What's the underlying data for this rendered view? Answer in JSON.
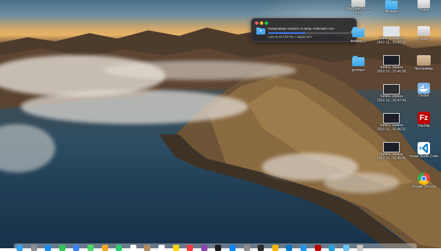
{
  "copy_dialog": {
    "title": "Копирование «Docker» в папку «Рабочий стол»",
    "status": "1,02 ГБ из 1,97 ГБ — около 10 с",
    "progress_fraction": 0.45,
    "cancel_glyph": "✕",
    "icon": "folder-icon"
  },
  "desktop_icons": [
    {
      "label": "MacBook Pro —",
      "label2": "Root",
      "icon": "drive-icon"
    },
    {
      "label": "Фильмы",
      "label2": "",
      "icon": "movies-folder-icon"
    },
    {
      "label": "Docker",
      "label2": "",
      "icon": "drive-icon"
    },
    {
      "label": "desktop_2",
      "label2": "",
      "icon": "folder-icon"
    },
    {
      "label": "Запись экрана",
      "label2": "2022-12...15.42.39",
      "icon": "screenshot-icon"
    },
    {
      "label": "Docker",
      "label2": "",
      "icon": "drive-icon"
    },
    {
      "label": "goshops",
      "label2": "",
      "icon": "folder-icon"
    },
    {
      "label": "Запись экрана",
      "label2": "2022-12...15.40.28",
      "icon": "screenshot-icon"
    },
    {
      "label": "Программы",
      "label2": "",
      "icon": "applications-folder-icon"
    },
    {
      "label": "Запись экрана",
      "label2": "2022-12...16.47.44",
      "icon": "screenshot-icon"
    },
    {
      "label": "Docker",
      "label2": "",
      "icon": "docker-icon"
    },
    {
      "label": "Запись экрана",
      "label2": "2022-12...16.46.21",
      "icon": "screenshot-icon"
    },
    {
      "label": "FileZilla",
      "label2": "",
      "icon": "filezilla-icon"
    },
    {
      "label": "Запись экрана",
      "label2": "2022-12...16.45.45",
      "icon": "screenshot-icon"
    },
    {
      "label": "Visual Studio Code",
      "label2": "",
      "icon": "vscode-icon"
    },
    {
      "label": "Google Chrome",
      "label2": "",
      "icon": "chrome-icon"
    }
  ],
  "dock": {
    "items": [
      "finder-icon",
      "launchpad-icon",
      "safari-icon",
      "messages-icon",
      "mail-icon",
      "maps-icon",
      "photos-icon",
      "facetime-icon",
      "calendar-icon",
      "contacts-icon",
      "reminders-icon",
      "notes-icon",
      "music-icon",
      "podcasts-icon",
      "tv-icon",
      "appstore-icon",
      "settings-icon",
      "terminal-icon",
      "chrome-icon",
      "vscode-icon",
      "docker-icon",
      "filezilla-icon",
      "telegram-icon",
      "folder-icon",
      "trash-icon"
    ],
    "colors": [
      "#3aa0f2",
      "#8e8e93",
      "#1d8cf5",
      "#34c759",
      "#3b82f6",
      "#4cd964",
      "#f5a623",
      "#2ecc71",
      "#ffffff",
      "#b38b5d",
      "#ffffff",
      "#ffd60a",
      "#fc3c44",
      "#8e44ad",
      "#1c1c1e",
      "#0a84ff",
      "#8e8e93",
      "#2b2b2b",
      "#f4b400",
      "#007acc",
      "#2496ed",
      "#bf0000",
      "#2aa1da",
      "#6cc3f5",
      "#c7c7cc"
    ]
  },
  "colors": {
    "accent": "#3b82f6"
  }
}
